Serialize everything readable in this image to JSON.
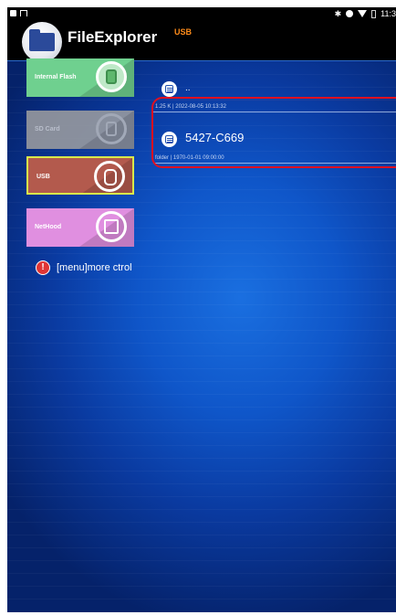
{
  "status_bar": {
    "time": "11:3",
    "icons": [
      "notification-icon",
      "download-icon",
      "bluetooth-icon",
      "location-icon",
      "wifi-icon",
      "battery-icon"
    ]
  },
  "header": {
    "app_title": "FileExplorer",
    "current_location": "USB",
    "location_color": "#ff8c1a"
  },
  "sidebar": {
    "items": [
      {
        "label": "Internal Flash",
        "icon": "flash-memory-icon",
        "color": "#6fd08f"
      },
      {
        "label": "SD Card",
        "icon": "sd-card-icon",
        "color": "#a0a0a0",
        "state": "disabled"
      },
      {
        "label": "USB",
        "icon": "usb-drive-icon",
        "color": "#b35a4d",
        "state": "selected"
      },
      {
        "label": "NetHood",
        "icon": "network-icon",
        "color": "#e08fe0"
      }
    ]
  },
  "hint": {
    "icon": "alert-icon",
    "text": "[menu]more ctrol"
  },
  "file_list": {
    "rows": [
      {
        "name": "..",
        "meta": "1.25 K | 2022-08-05 10:13:32",
        "icon": "folder-icon"
      },
      {
        "name": "5427-C669",
        "meta": "folder | 1970-01-01 09:00:00",
        "icon": "folder-icon"
      }
    ]
  },
  "colors": {
    "background": "#0f56c9",
    "highlight": "#e01020",
    "selection_border": "#d8e84a"
  }
}
